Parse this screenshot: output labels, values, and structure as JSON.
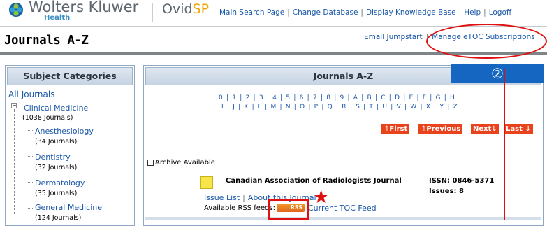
{
  "header": {
    "brand": "Wolters Kluwer",
    "brand_sub": "Health",
    "product": "Ovid",
    "product_accent": "SP",
    "nav": [
      "Main Search Page",
      "Change Database",
      "Display Knowledge Base",
      "Help",
      "Logoff"
    ]
  },
  "page": {
    "title": "Journals A-Z",
    "subnav": [
      "Email Jumpstart",
      "Manage eTOC Subscriptions"
    ]
  },
  "left": {
    "heading": "Subject Categories",
    "all": "All Journals",
    "category": "Clinical Medicine",
    "category_count": "(1038 Journals)",
    "subcategories": [
      {
        "label": "Anesthesiology",
        "count": "(34 Journals)"
      },
      {
        "label": "Dentistry",
        "count": "(32 Journals)"
      },
      {
        "label": "Dermatology",
        "count": "(35 Journals)"
      },
      {
        "label": "General Medicine",
        "count": "(124 Journals)"
      }
    ]
  },
  "main": {
    "heading": "Journals A-Z",
    "overlay_marker": "②",
    "alpha_row1": "0 | 1 | 2 | 3 | 4 | 5 | 6 | 7 | 8 | 9 | A | B | C | D | E | F | G | H",
    "alpha_row2": "I | J | K | L | M | N | O | P | Q | R | S | T | U | V | W | X | Y | Z",
    "pager": [
      "⇑First",
      "⇑Previous",
      "Next⇓",
      "Last ⇓"
    ],
    "archive_label": "Archive Available",
    "journal": {
      "name": "Canadian Association of Radiologists Journal",
      "issn": "ISSN: 0846-5371",
      "issues": "Issues: 8",
      "link_issue_list": "Issue List",
      "link_about": "About this Journal",
      "rss_label": "Available RSS feeds:",
      "rss_badge": "RSS",
      "toc_feed": "Current TOC Feed"
    }
  },
  "annotations": {
    "star": "★"
  },
  "colors": {
    "link": "#1a57a8",
    "pager_button": "#e8431c",
    "annotation_red": "#e01010",
    "overlay_blue": "#1566c0"
  }
}
